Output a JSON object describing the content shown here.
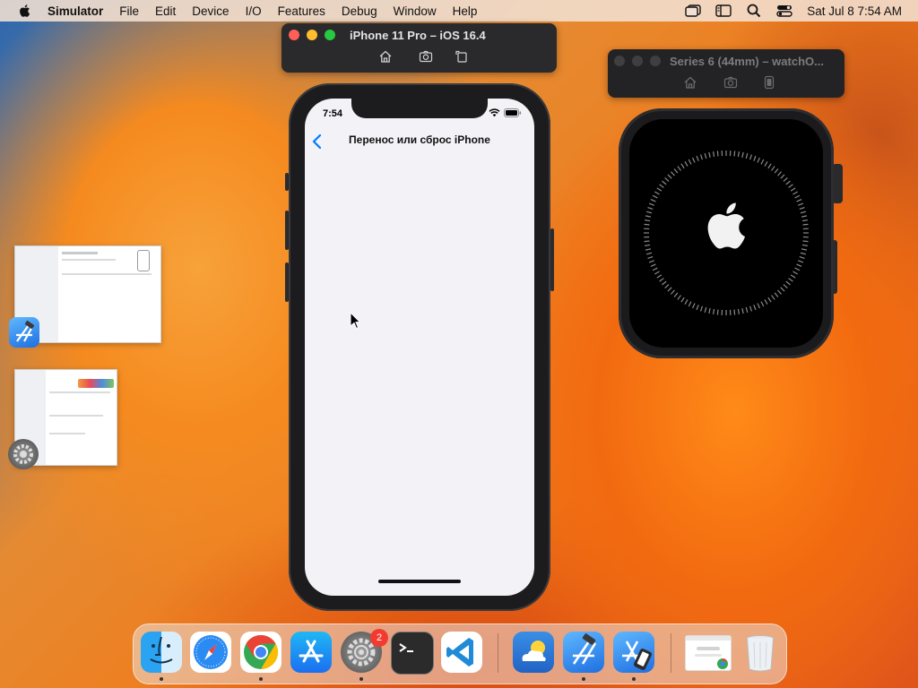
{
  "menubar": {
    "app_name": "Simulator",
    "items": [
      "File",
      "Edit",
      "Device",
      "I/O",
      "Features",
      "Debug",
      "Window",
      "Help"
    ],
    "clock": "Sat Jul 8  7:54 AM"
  },
  "iphone_window": {
    "title": "iPhone 11 Pro – iOS 16.4",
    "toolbar": [
      "home-icon",
      "screenshot-icon",
      "rotate-icon"
    ]
  },
  "watch_window": {
    "title": "Series 6 (44mm) – watchO...",
    "toolbar": [
      "home-icon",
      "screenshot-icon",
      "side-button-icon"
    ]
  },
  "iphone_screen": {
    "status_time": "7:54",
    "nav_title": "Перенос или сброс iPhone"
  },
  "watch_screen": {
    "logo": "apple-logo",
    "state": "booting"
  },
  "thumbnails": [
    {
      "app": "Xcode",
      "icon": "xcode-icon"
    },
    {
      "app": "System Settings",
      "icon": "settings-icon"
    }
  ],
  "dock": {
    "apps": [
      {
        "name": "Finder",
        "icon": "finder-icon",
        "running": true
      },
      {
        "name": "Safari",
        "icon": "safari-icon",
        "running": false
      },
      {
        "name": "Google Chrome",
        "icon": "chrome-icon",
        "running": true
      },
      {
        "name": "App Store",
        "icon": "app-store-icon",
        "running": false
      },
      {
        "name": "System Settings",
        "icon": "settings-icon",
        "running": true,
        "badge": "2"
      },
      {
        "name": "Terminal",
        "icon": "terminal-icon",
        "running": false
      },
      {
        "name": "Visual Studio Code",
        "icon": "vscode-icon",
        "running": false
      },
      {
        "name": "Weather",
        "icon": "weather-icon",
        "running": false
      },
      {
        "name": "Xcode",
        "icon": "xcode-icon",
        "running": true
      },
      {
        "name": "Simulator",
        "icon": "simulator-icon",
        "running": true
      },
      {
        "name": "Chrome Window",
        "icon": "chrome-window-icon",
        "running": false
      },
      {
        "name": "Trash",
        "icon": "trash-icon",
        "running": false
      }
    ]
  },
  "colors": {
    "ios_accent": "#007aff",
    "badge_red": "#f23b30",
    "traffic_close": "#fe5f57",
    "traffic_min": "#febc2e",
    "traffic_max": "#28c840"
  }
}
